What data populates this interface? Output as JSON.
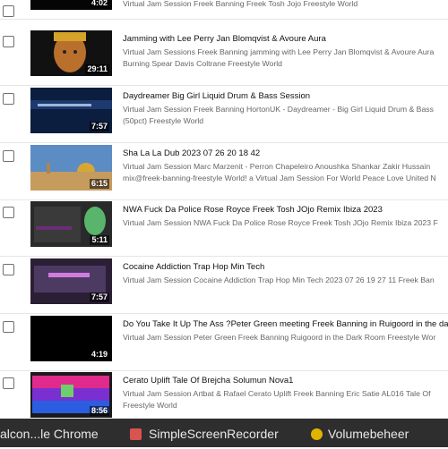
{
  "videos": [
    {
      "title": "",
      "description": "Virtual Jam Session Freek Banning Freek Tosh Jojo Freestyle World",
      "duration": "4:02"
    },
    {
      "title": "Jamming with Lee Perry Jan Blomqvist & Avoure Aura",
      "description": "Virtual Jam Sessions Freek Banning jamming with Lee Perry Jan Blomqvist & Avoure Aura Burning Spear Davis Coltrane Freestyle World",
      "duration": "29:11"
    },
    {
      "title": "Daydreamer Big Girl Liquid Drum & Bass Session",
      "description": "Virtual Jam Session Freek Banning HortonUK - Daydreamer - Big Girl Liquid Drum & Bass (50pct) Freestyle World",
      "duration": "7:57"
    },
    {
      "title": "Sha La La Dub 2023 07 26 20 18 42",
      "description": "Virtual Jam Session Marc Marzenit - Perron Chapeleiro Anoushka Shankar Zakir Hussain mix@freek-banning-freestyle World! a Virtual Jam Session For World Peace Love United N",
      "duration": "6:15"
    },
    {
      "title": "NWA Fuck Da Police Rose Royce Freek Tosh JOjo Remix Ibiza 2023",
      "description": "Virtual Jam Session NWA Fuck Da Police Rose Royce Freek Tosh JOjo Remix Ibiza 2023 F",
      "duration": "5:11"
    },
    {
      "title": "Cocaine Addiction Trap Hop Min Tech",
      "description": "Virtual Jam Session Cocaine Addiction Trap Hop Min Tech 2023 07 26 19 27 11 Freek Ban",
      "duration": "7:57"
    },
    {
      "title": "Do You Take It Up The Ass ?Peter Green meeting Freek Banning in Ruigoord in the da",
      "description": "Virtual Jam Session Peter Green Freek Banning Ruigoord in the Dark Room Freestyle Wor",
      "duration": "4:19"
    },
    {
      "title": "Cerato Uplift Tale Of Brejcha Solumun Nova1",
      "description": "Virtual Jam Session Artbat & Rafael Cerato Uplift Freek Banning Eric Satie AL016 Tale Of Freestyle World",
      "duration": "8:56"
    }
  ],
  "taskbar": {
    "chrome_label": "alcon...le Chrome",
    "recorder_label": "SimpleScreenRecorder",
    "volume_label": "Volumebeheer"
  }
}
